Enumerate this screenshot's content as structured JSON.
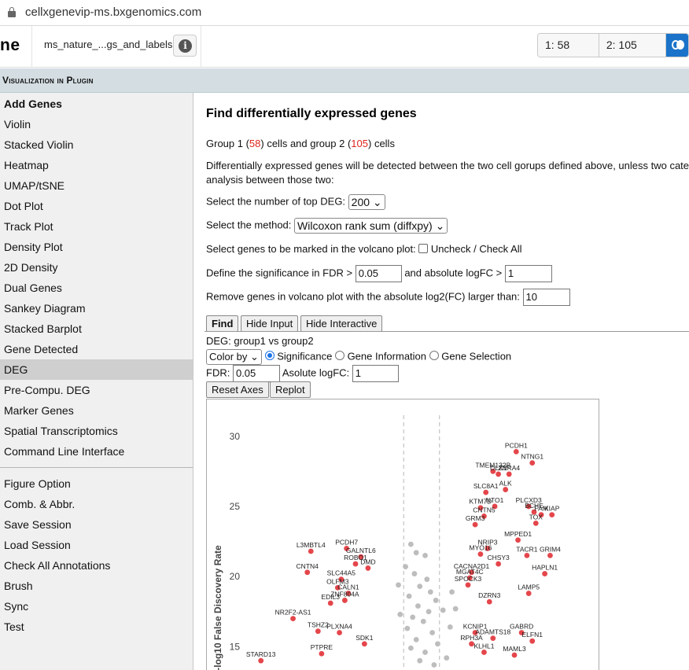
{
  "browser": {
    "url": "cellxgenevip-ms.bxgenomics.com"
  },
  "header": {
    "logo": "ne",
    "dataset": "ms_nature_...gs_and_labels",
    "info_icon": "info-icon",
    "cell_groups": [
      "1: 58 cells",
      "2: 105 cells"
    ],
    "toggle_icon": "venn-toggle-icon"
  },
  "section": {
    "title": "Visualization in Plugin"
  },
  "sidebar": {
    "items": [
      "Add Genes",
      "Violin",
      "Stacked Violin",
      "Heatmap",
      "UMAP/tSNE",
      "Dot Plot",
      "Track Plot",
      "Density Plot",
      "2D Density",
      "Dual Genes",
      "Sankey Diagram",
      "Stacked Barplot",
      "Gene Detected",
      "DEG",
      "Pre-Compu. DEG",
      "Marker Genes",
      "Spatial Transcriptomics",
      "Command Line Interface"
    ],
    "items2": [
      "Figure Option",
      "Comb. & Abbr.",
      "Save Session",
      "Load Session",
      "Check All Annotations",
      "Brush",
      "Sync",
      "Test"
    ],
    "active": "DEG"
  },
  "main": {
    "title": "Find differentially expressed genes",
    "groups": {
      "p1": "Group 1 (",
      "n1": "58",
      "p2": ") cells and group 2 (",
      "n2": "105",
      "p3": ") cells"
    },
    "desc1": "Differentially expressed genes will be detected between the two cell gorups defined above, unless two categories",
    "desc2": "analysis between those two:",
    "topdeg_label": "Select the number of top DEG:",
    "topdeg_value": "200",
    "method_label": "Select the method:",
    "method_value": "Wilcoxon rank sum (diffxpy)",
    "mark_label": "Select genes to be marked in the volcano plot:",
    "check_label": "Uncheck / Check All",
    "fdr_label": "Define the significance in FDR >",
    "fdr_value": "0.05",
    "logfc_label": "and absolute logFC >",
    "logfc_value": "1",
    "remove_label": "Remove genes in volcano plot with the absolute log2(FC) larger than:",
    "remove_value": "10",
    "buttons": {
      "find": "Find",
      "hide_input": "Hide Input",
      "hide_interactive": "Hide Interactive"
    },
    "deg_title": "DEG: group1 vs group2",
    "color_by": "Color by",
    "radios": [
      "Significance",
      "Gene Information",
      "Gene Selection"
    ],
    "fdr2_label": "FDR:",
    "fdr2_value": "0.05",
    "asolute_label": "Asolute logFC:",
    "asolute_value": "1",
    "reset_axes": "Reset Axes",
    "replot": "Replot"
  },
  "chart_data": {
    "type": "scatter",
    "title": "",
    "ylabel": "-log10 False Discovery Rate",
    "xlabel": "",
    "ylim": [
      13,
      31.5
    ],
    "xlim": [
      -10,
      10
    ],
    "y_ticks": [
      15,
      20,
      25,
      30
    ],
    "thresholds": {
      "fdr": 0.05,
      "logfc": 1
    },
    "colors": {
      "significant": "#e4464b",
      "other": "#bdbdbd",
      "threshold": "#c8c8c8"
    },
    "significant": [
      {
        "label": "PCDH1",
        "x": 5.3,
        "y": 28.9
      },
      {
        "label": "NTNG1",
        "x": 6.2,
        "y": 28.1
      },
      {
        "label": "TMEM132B",
        "x": 4.0,
        "y": 27.5
      },
      {
        "label": "DLX1",
        "x": 4.3,
        "y": 27.3
      },
      {
        "label": "ZNRA4",
        "x": 4.9,
        "y": 27.3
      },
      {
        "label": "SLC8A1",
        "x": 3.6,
        "y": 26.0
      },
      {
        "label": "ALK",
        "x": 4.7,
        "y": 26.2
      },
      {
        "label": "PLCXD3",
        "x": 6.0,
        "y": 25.0
      },
      {
        "label": "BCHE",
        "x": 6.3,
        "y": 24.6
      },
      {
        "label": "FAM",
        "x": 6.7,
        "y": 24.4
      },
      {
        "label": "KIAP",
        "x": 7.3,
        "y": 24.4
      },
      {
        "label": "KTM7D",
        "x": 3.3,
        "y": 24.9
      },
      {
        "label": "NTO1",
        "x": 4.1,
        "y": 25.0
      },
      {
        "label": "CNTN5",
        "x": 3.5,
        "y": 24.3
      },
      {
        "label": "TOX",
        "x": 6.4,
        "y": 23.8
      },
      {
        "label": "GRM3",
        "x": 3.0,
        "y": 23.7
      },
      {
        "label": "MPPED1",
        "x": 5.4,
        "y": 22.6
      },
      {
        "label": "NRIP3",
        "x": 3.7,
        "y": 22.0
      },
      {
        "label": "MYO16",
        "x": 3.3,
        "y": 21.6
      },
      {
        "label": "TACR1",
        "x": 5.9,
        "y": 21.5
      },
      {
        "label": "GRIM4",
        "x": 7.2,
        "y": 21.5
      },
      {
        "label": "CHSY3",
        "x": 4.3,
        "y": 20.9
      },
      {
        "label": "HAPLN1",
        "x": 6.9,
        "y": 20.2
      },
      {
        "label": "CACNA2D1",
        "x": 2.8,
        "y": 20.3
      },
      {
        "label": "MGAT4C",
        "x": 2.7,
        "y": 19.9
      },
      {
        "label": "SPOCK3",
        "x": 2.6,
        "y": 19.4
      },
      {
        "label": "LAMP5",
        "x": 6.0,
        "y": 18.8
      },
      {
        "label": "DZRN3",
        "x": 3.8,
        "y": 18.2
      },
      {
        "label": "GABRD",
        "x": 5.6,
        "y": 16.0
      },
      {
        "label": "ELFN1",
        "x": 6.2,
        "y": 15.4
      },
      {
        "label": "KCNIP1",
        "x": 3.0,
        "y": 16.0
      },
      {
        "label": "ADAMTS18",
        "x": 4.0,
        "y": 15.6
      },
      {
        "label": "RPH3A",
        "x": 2.8,
        "y": 15.2
      },
      {
        "label": "KLHL1",
        "x": 3.5,
        "y": 14.6
      },
      {
        "label": "MAML3",
        "x": 5.2,
        "y": 14.4
      },
      {
        "label": "L3MBTL4",
        "x": -6.2,
        "y": 21.8
      },
      {
        "label": "PCDH7",
        "x": -4.2,
        "y": 22.0
      },
      {
        "label": "GALNTL6",
        "x": -3.4,
        "y": 21.4
      },
      {
        "label": "ROBO1",
        "x": -3.7,
        "y": 20.9
      },
      {
        "label": "DMD",
        "x": -3.0,
        "y": 20.6
      },
      {
        "label": "CNTN4",
        "x": -6.4,
        "y": 20.3
      },
      {
        "label": "SLC44A5",
        "x": -4.5,
        "y": 19.8
      },
      {
        "label": "OLFM3",
        "x": -4.7,
        "y": 19.2
      },
      {
        "label": "CALN1",
        "x": -4.1,
        "y": 18.8
      },
      {
        "label": "ZNF804A",
        "x": -4.3,
        "y": 18.3
      },
      {
        "label": "EDIL3",
        "x": -5.1,
        "y": 18.1
      },
      {
        "label": "NR2F2-AS1",
        "x": -7.2,
        "y": 17.0
      },
      {
        "label": "TSHZ2",
        "x": -5.8,
        "y": 16.1
      },
      {
        "label": "PLXNA4",
        "x": -4.6,
        "y": 16.0
      },
      {
        "label": "SDK1",
        "x": -3.2,
        "y": 15.2
      },
      {
        "label": "PTPRE",
        "x": -5.6,
        "y": 14.5
      },
      {
        "label": "STARD13",
        "x": -9.0,
        "y": 14.0
      }
    ],
    "nonsignificant": [
      {
        "x": -0.6,
        "y": 22.3
      },
      {
        "x": -0.3,
        "y": 21.7
      },
      {
        "x": 0.2,
        "y": 21.5
      },
      {
        "x": -0.9,
        "y": 20.7
      },
      {
        "x": -0.4,
        "y": 20.2
      },
      {
        "x": 0.3,
        "y": 19.8
      },
      {
        "x": -0.1,
        "y": 19.3
      },
      {
        "x": 0.5,
        "y": 18.9
      },
      {
        "x": -0.7,
        "y": 18.6
      },
      {
        "x": 0.8,
        "y": 18.3
      },
      {
        "x": -0.2,
        "y": 17.9
      },
      {
        "x": 0.4,
        "y": 17.5
      },
      {
        "x": -0.5,
        "y": 17.1
      },
      {
        "x": 1.2,
        "y": 17.6
      },
      {
        "x": 0.1,
        "y": 16.8
      },
      {
        "x": -0.8,
        "y": 16.3
      },
      {
        "x": 0.6,
        "y": 16.0
      },
      {
        "x": -0.3,
        "y": 15.5
      },
      {
        "x": 0.9,
        "y": 15.2
      },
      {
        "x": -0.6,
        "y": 14.9
      },
      {
        "x": 0.2,
        "y": 14.6
      },
      {
        "x": 1.4,
        "y": 14.2
      },
      {
        "x": -0.1,
        "y": 14.0
      },
      {
        "x": 0.7,
        "y": 13.7
      },
      {
        "x": 1.7,
        "y": 18.9
      },
      {
        "x": 1.9,
        "y": 17.7
      },
      {
        "x": 1.6,
        "y": 16.4
      },
      {
        "x": -1.3,
        "y": 19.4
      },
      {
        "x": -1.2,
        "y": 17.3
      }
    ]
  }
}
